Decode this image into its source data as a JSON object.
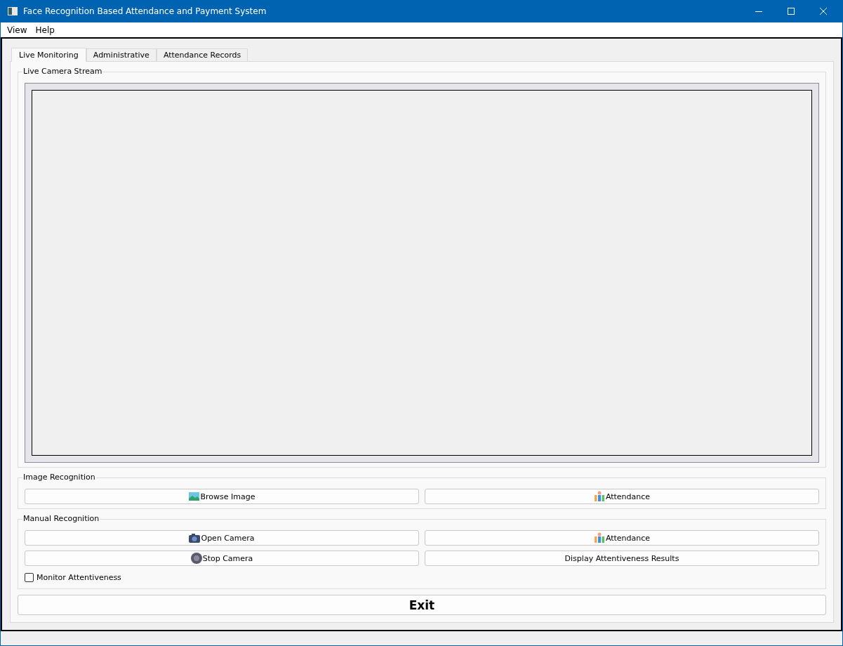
{
  "window": {
    "title": "Face Recognition Based Attendance and Payment System"
  },
  "menu": [
    "View",
    "Help"
  ],
  "tabs": [
    {
      "label": "Live Monitoring",
      "selected": true
    },
    {
      "label": "Administrative",
      "selected": false
    },
    {
      "label": "Attendance Records",
      "selected": false
    }
  ],
  "camera_group": {
    "title": "Live Camera Stream"
  },
  "image_group": {
    "title": "Image Recognition",
    "buttons": [
      {
        "label": "Browse Image",
        "kind": "image"
      },
      {
        "label": "Attendance",
        "kind": "people"
      }
    ]
  },
  "manual_group": {
    "title": "Manual Recognition",
    "buttons": [
      {
        "label": "Open Camera",
        "kind": "camera"
      },
      {
        "label": "Attendance",
        "kind": "people"
      },
      {
        "label": "Stop Camera",
        "kind": "stop"
      },
      {
        "label": "Display Attentiveness Results",
        "kind": "plain"
      }
    ],
    "checkbox": {
      "label": "Monitor Attentiveness",
      "checked": false
    }
  },
  "exit_button": {
    "label": "Exit"
  }
}
